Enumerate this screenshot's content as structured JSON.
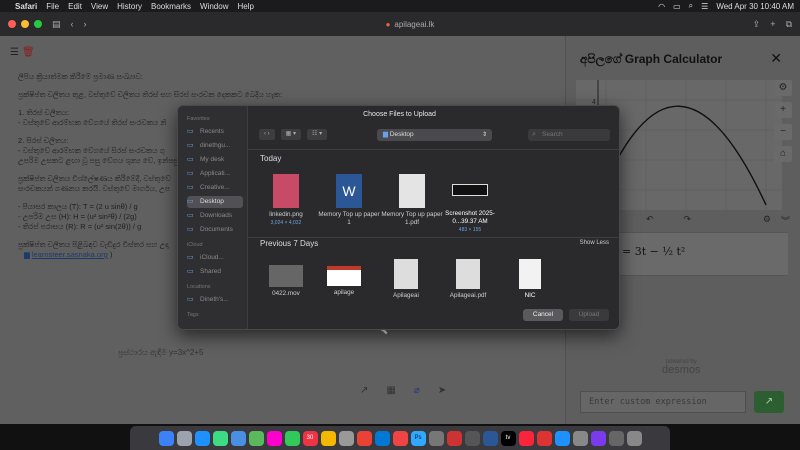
{
  "menubar": {
    "app": "Safari",
    "items": [
      "File",
      "Edit",
      "View",
      "History",
      "Bookmarks",
      "Window",
      "Help"
    ],
    "datetime": "Wed Apr 30  10:40 AM"
  },
  "browser": {
    "url": "apilageai.lk"
  },
  "doc": {
    "lines": [
      "ලිපිය ක්‍රියාත්මක කිරීමේ ප්‍රමාණ සංඛ්‍යාව:",
      "",
      "ප්‍රක්ෂිප්ත චලිතය තුළ, වස්තුවේ චලිතය තිරස් සහ සිරස් සංරචක දෙකකට බෙදිය හැක:",
      "",
      "1. තිරස් චලිතය:",
      "- වස්තුවේ ආරම්භක වේගයේ තිරස් සංරචකය නි",
      "",
      "2. සිරස් චලිතය:",
      "- වස්තුවේ ආරම්භක වේගයේ සිරස් සංරචකය ගු",
      "උපරිම උසකට ළඟා වූ පසු වේගය ශුන්‍ය වේ, ඉන්පසු වස්තුව",
      "",
      "ප්‍රක්ෂිප්ත චලිතය විශ්ලේෂණය කිරීමේදී, වස්තුවේ",
      "සංරචකයන් ගණනය කරයි. වස්තුවේ මාර්ගය, උප",
      "",
      "- පියාසර කාලය (T): T = (2 u sinθ) / g",
      "- උපරිම උස (H): H = (u² sin²θ) / (2g)",
      "- තිරස් පරාසය (R): R = (u² sin(2θ)) / g",
      "",
      "ප්‍රක්ෂිප්ත චලිතය පිළිබඳව වැඩිදුර විස්තර සහ උදා"
    ],
    "link": "learnsteer.sasnaka.org",
    "link_suffix": ")",
    "prompt": "ප්‍රස්ථාරය ඇඳීම y=3x^2+5"
  },
  "graph_calc": {
    "title": "අපිලගේ Graph Calculator",
    "tick_label": "4",
    "expression": "= 3t − ½ t²",
    "powered_by": "powered by",
    "brand": "desmos",
    "input_placeholder": "Enter custom expression"
  },
  "dialog": {
    "title": "Choose Files to Upload",
    "location": "Desktop",
    "search_placeholder": "Search",
    "sidebar": {
      "favorites_header": "Favorites",
      "favorites": [
        "Recents",
        "dinethgu...",
        "My desk",
        "Applicati...",
        "Creative...",
        "Desktop",
        "Downloads",
        "Documents"
      ],
      "icloud_header": "iCloud",
      "icloud": [
        "iCloud...",
        "Shared"
      ],
      "locations_header": "Locations",
      "locations": [
        "Dineth's..."
      ],
      "tags_header": "Tags"
    },
    "today_header": "Today",
    "today_files": [
      {
        "name": "linkedin.png",
        "sub": "3,024 × 4,032"
      },
      {
        "name": "Memory Top up paper 1",
        "sub": ""
      },
      {
        "name": "Memory Top up paper 1.pdf",
        "sub": ""
      },
      {
        "name": "Screenshot 2025-0...39.37 AM",
        "sub": "483 × 155"
      }
    ],
    "week_header": "Previous 7 Days",
    "show_less": "Show Less",
    "week_files": [
      {
        "name": "0422.mov"
      },
      {
        "name": "apilage"
      },
      {
        "name": "Apilageai"
      },
      {
        "name": "Apilageai.pdf"
      },
      {
        "name": "NIC"
      }
    ],
    "cancel": "Cancel",
    "upload": "Upload"
  }
}
